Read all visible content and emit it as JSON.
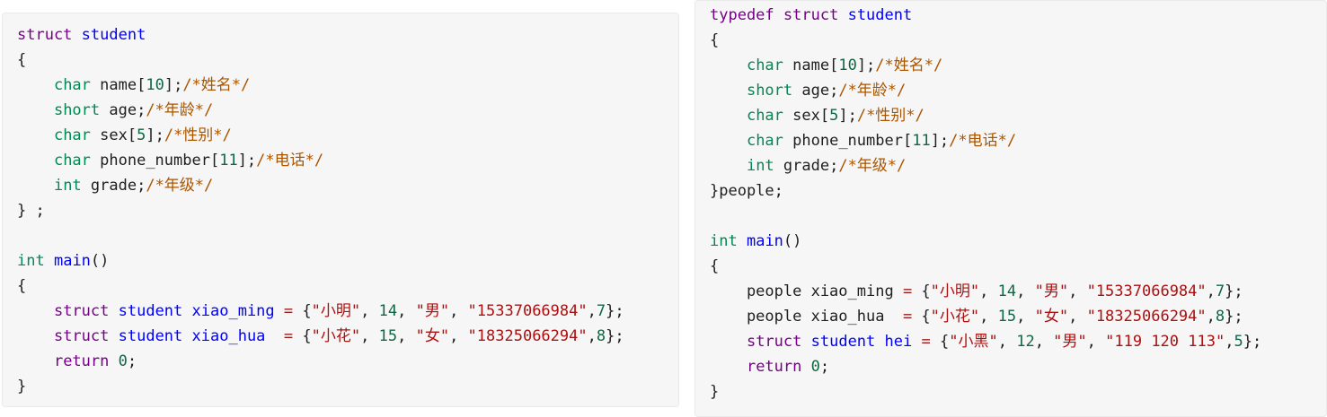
{
  "left_block": {
    "lines": [
      [
        {
          "t": "struct",
          "c": "kw"
        },
        {
          "t": " "
        },
        {
          "t": "student",
          "c": "df"
        }
      ],
      [
        {
          "t": "{"
        }
      ],
      [
        {
          "t": "    "
        },
        {
          "t": "char",
          "c": "ty"
        },
        {
          "t": " name"
        },
        {
          "t": "[",
          "c": "pl"
        },
        {
          "t": "10",
          "c": "num"
        },
        {
          "t": "];"
        },
        {
          "t": "/*姓名*/",
          "c": "cm"
        }
      ],
      [
        {
          "t": "    "
        },
        {
          "t": "short",
          "c": "ty"
        },
        {
          "t": " age;"
        },
        {
          "t": "/*年龄*/",
          "c": "cm"
        }
      ],
      [
        {
          "t": "    "
        },
        {
          "t": "char",
          "c": "ty"
        },
        {
          "t": " sex["
        },
        {
          "t": "5",
          "c": "num"
        },
        {
          "t": "];"
        },
        {
          "t": "/*性别*/",
          "c": "cm"
        }
      ],
      [
        {
          "t": "    "
        },
        {
          "t": "char",
          "c": "ty"
        },
        {
          "t": " phone_number["
        },
        {
          "t": "11",
          "c": "num"
        },
        {
          "t": "];"
        },
        {
          "t": "/*电话*/",
          "c": "cm"
        }
      ],
      [
        {
          "t": "    "
        },
        {
          "t": "int",
          "c": "ty"
        },
        {
          "t": " grade;"
        },
        {
          "t": "/*年级*/",
          "c": "cm"
        }
      ],
      [
        {
          "t": "} ;"
        }
      ],
      [
        {
          "t": ""
        }
      ],
      [
        {
          "t": "int",
          "c": "ty"
        },
        {
          "t": " "
        },
        {
          "t": "main",
          "c": "df"
        },
        {
          "t": "()"
        }
      ],
      [
        {
          "t": "{"
        }
      ],
      [
        {
          "t": "    "
        },
        {
          "t": "struct",
          "c": "kw"
        },
        {
          "t": " "
        },
        {
          "t": "student",
          "c": "df"
        },
        {
          "t": " "
        },
        {
          "t": "xiao_ming",
          "c": "df"
        },
        {
          "t": " "
        },
        {
          "t": "=",
          "c": "op"
        },
        {
          "t": " {"
        },
        {
          "t": "\"小明\"",
          "c": "str"
        },
        {
          "t": ", "
        },
        {
          "t": "14",
          "c": "num"
        },
        {
          "t": ", "
        },
        {
          "t": "\"男\"",
          "c": "str"
        },
        {
          "t": ", "
        },
        {
          "t": "\"15337066984\"",
          "c": "str"
        },
        {
          "t": ","
        },
        {
          "t": "7",
          "c": "num"
        },
        {
          "t": "};"
        }
      ],
      [
        {
          "t": "    "
        },
        {
          "t": "struct",
          "c": "kw"
        },
        {
          "t": " "
        },
        {
          "t": "student",
          "c": "df"
        },
        {
          "t": " "
        },
        {
          "t": "xiao_hua",
          "c": "df"
        },
        {
          "t": "  "
        },
        {
          "t": "=",
          "c": "op"
        },
        {
          "t": " {"
        },
        {
          "t": "\"小花\"",
          "c": "str"
        },
        {
          "t": ", "
        },
        {
          "t": "15",
          "c": "num"
        },
        {
          "t": ", "
        },
        {
          "t": "\"女\"",
          "c": "str"
        },
        {
          "t": ", "
        },
        {
          "t": "\"18325066294\"",
          "c": "str"
        },
        {
          "t": ","
        },
        {
          "t": "8",
          "c": "num"
        },
        {
          "t": "};"
        }
      ],
      [
        {
          "t": "    "
        },
        {
          "t": "return",
          "c": "kw"
        },
        {
          "t": " "
        },
        {
          "t": "0",
          "c": "num"
        },
        {
          "t": ";"
        }
      ],
      [
        {
          "t": "}"
        }
      ]
    ]
  },
  "right_block": {
    "lines": [
      [
        {
          "t": "typedef",
          "c": "kw"
        },
        {
          "t": " "
        },
        {
          "t": "struct",
          "c": "kw"
        },
        {
          "t": " "
        },
        {
          "t": "student",
          "c": "df"
        }
      ],
      [
        {
          "t": "{"
        }
      ],
      [
        {
          "t": "    "
        },
        {
          "t": "char",
          "c": "ty"
        },
        {
          "t": " name["
        },
        {
          "t": "10",
          "c": "num"
        },
        {
          "t": "];"
        },
        {
          "t": "/*姓名*/",
          "c": "cm"
        }
      ],
      [
        {
          "t": "    "
        },
        {
          "t": "short",
          "c": "ty"
        },
        {
          "t": " age;"
        },
        {
          "t": "/*年龄*/",
          "c": "cm"
        }
      ],
      [
        {
          "t": "    "
        },
        {
          "t": "char",
          "c": "ty"
        },
        {
          "t": " sex["
        },
        {
          "t": "5",
          "c": "num"
        },
        {
          "t": "];"
        },
        {
          "t": "/*性别*/",
          "c": "cm"
        }
      ],
      [
        {
          "t": "    "
        },
        {
          "t": "char",
          "c": "ty"
        },
        {
          "t": " phone_number["
        },
        {
          "t": "11",
          "c": "num"
        },
        {
          "t": "];"
        },
        {
          "t": "/*电话*/",
          "c": "cm"
        }
      ],
      [
        {
          "t": "    "
        },
        {
          "t": "int",
          "c": "ty"
        },
        {
          "t": " grade;"
        },
        {
          "t": "/*年级*/",
          "c": "cm"
        }
      ],
      [
        {
          "t": "}people;"
        }
      ],
      [
        {
          "t": ""
        }
      ],
      [
        {
          "t": "int",
          "c": "ty"
        },
        {
          "t": " "
        },
        {
          "t": "main",
          "c": "df"
        },
        {
          "t": "()"
        }
      ],
      [
        {
          "t": "{"
        }
      ],
      [
        {
          "t": "    people xiao_ming "
        },
        {
          "t": "=",
          "c": "op"
        },
        {
          "t": " {"
        },
        {
          "t": "\"小明\"",
          "c": "str"
        },
        {
          "t": ", "
        },
        {
          "t": "14",
          "c": "num"
        },
        {
          "t": ", "
        },
        {
          "t": "\"男\"",
          "c": "str"
        },
        {
          "t": ", "
        },
        {
          "t": "\"15337066984\"",
          "c": "str"
        },
        {
          "t": ","
        },
        {
          "t": "7",
          "c": "num"
        },
        {
          "t": "};"
        }
      ],
      [
        {
          "t": "    people xiao_hua  "
        },
        {
          "t": "=",
          "c": "op"
        },
        {
          "t": " {"
        },
        {
          "t": "\"小花\"",
          "c": "str"
        },
        {
          "t": ", "
        },
        {
          "t": "15",
          "c": "num"
        },
        {
          "t": ", "
        },
        {
          "t": "\"女\"",
          "c": "str"
        },
        {
          "t": ", "
        },
        {
          "t": "\"18325066294\"",
          "c": "str"
        },
        {
          "t": ","
        },
        {
          "t": "8",
          "c": "num"
        },
        {
          "t": "};"
        }
      ],
      [
        {
          "t": "    "
        },
        {
          "t": "struct",
          "c": "kw"
        },
        {
          "t": " "
        },
        {
          "t": "student",
          "c": "df"
        },
        {
          "t": " "
        },
        {
          "t": "hei",
          "c": "df"
        },
        {
          "t": " "
        },
        {
          "t": "=",
          "c": "op"
        },
        {
          "t": " {"
        },
        {
          "t": "\"小黑\"",
          "c": "str"
        },
        {
          "t": ", "
        },
        {
          "t": "12",
          "c": "num"
        },
        {
          "t": ", "
        },
        {
          "t": "\"男\"",
          "c": "str"
        },
        {
          "t": ", "
        },
        {
          "t": "\"119 120 113\"",
          "c": "str"
        },
        {
          "t": ","
        },
        {
          "t": "5",
          "c": "num"
        },
        {
          "t": "};"
        }
      ],
      [
        {
          "t": "    "
        },
        {
          "t": "return",
          "c": "kw"
        },
        {
          "t": " "
        },
        {
          "t": "0",
          "c": "num"
        },
        {
          "t": ";"
        }
      ],
      [
        {
          "t": "}"
        }
      ]
    ]
  }
}
